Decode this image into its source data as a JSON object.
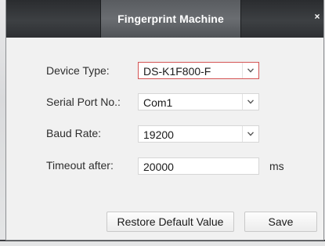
{
  "dialog": {
    "title": "Fingerprint Machine"
  },
  "form": {
    "device_type": {
      "label": "Device Type:",
      "value": "DS-K1F800-F"
    },
    "serial_port": {
      "label": "Serial Port No.:",
      "value": "Com1"
    },
    "baud_rate": {
      "label": "Baud Rate:",
      "value": "19200"
    },
    "timeout": {
      "label": "Timeout after:",
      "value": "20000",
      "unit": "ms"
    }
  },
  "buttons": {
    "restore_label": "Restore Default Value",
    "save_label": "Save"
  },
  "colors": {
    "titlebar": "#2e3033",
    "focus_border": "#d45454",
    "dialog_bg": "#f1f1f1"
  },
  "icons": {
    "close": "close-icon",
    "dropdown": "chevron-down-icon"
  }
}
